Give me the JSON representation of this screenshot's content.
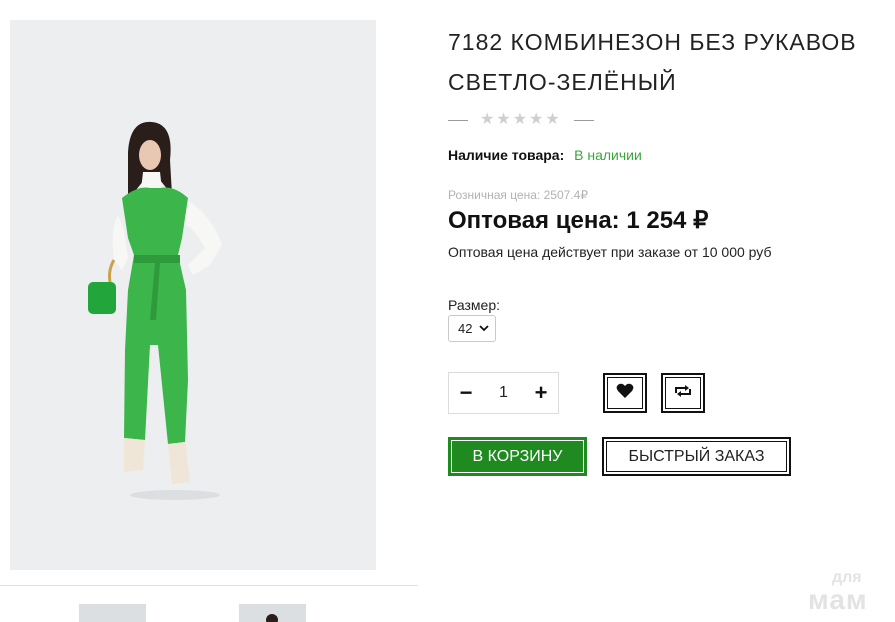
{
  "product": {
    "title": "7182 КОМБИНЕЗОН БЕЗ РУКАВОВ СВЕТЛО-ЗЕЛЁНЫЙ",
    "rating": {
      "value": 0,
      "max": 5
    },
    "availability_label": "Наличие товара:",
    "availability_value": "В наличии",
    "retail_price_text": "Розничная цена: 2507.4₽",
    "wholesale_price_text": "Оптовая цена: 1 254",
    "currency": "₽",
    "wholesale_note": "Оптовая цена действует при заказе от 10 000 руб",
    "size_label": "Размер:",
    "size_selected": "42",
    "quantity": "1"
  },
  "actions": {
    "minus": "−",
    "plus": "+",
    "add_to_cart": "В КОРЗИНУ",
    "quick_order": "БЫСТРЫЙ ЗАКАЗ"
  },
  "watermark": {
    "line1": "для",
    "line2": "мам"
  },
  "colors": {
    "accent_green": "#1f8a1f",
    "in_stock_green": "#3aa63a"
  },
  "icons": {
    "favorite": "heart-icon",
    "compare": "compare-arrows-icon",
    "dropdown": "chevron-down-icon"
  }
}
